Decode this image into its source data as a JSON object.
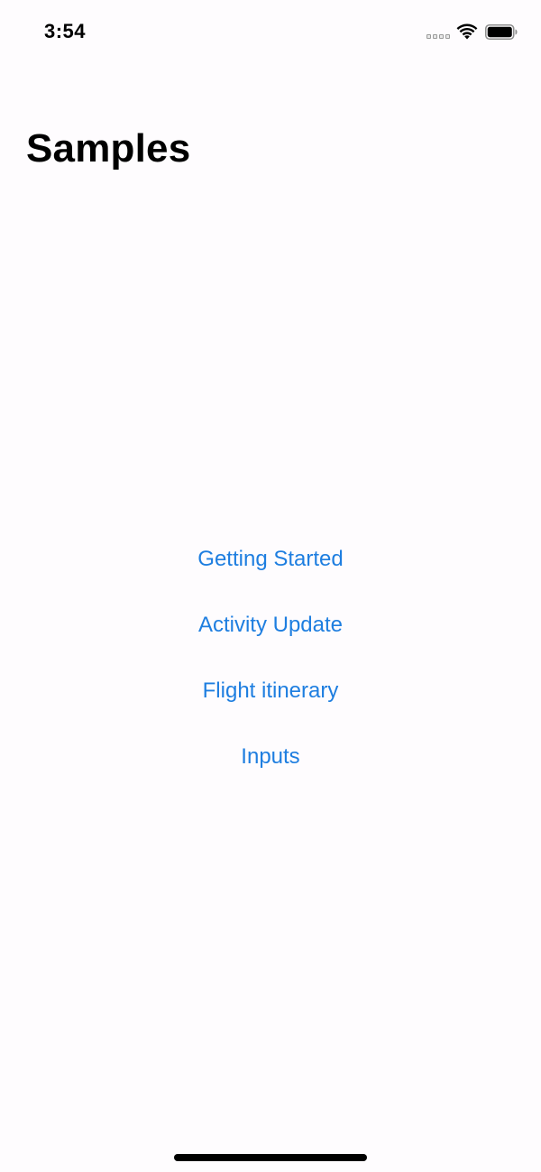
{
  "status_bar": {
    "time": "3:54",
    "icons": [
      "cellular-signal-icon",
      "wifi-icon",
      "battery-icon"
    ]
  },
  "page": {
    "title": "Samples"
  },
  "menu": {
    "items": [
      {
        "label": "Getting Started"
      },
      {
        "label": "Activity Update"
      },
      {
        "label": "Flight itinerary"
      },
      {
        "label": "Inputs"
      }
    ]
  },
  "colors": {
    "link": "#1e7ee0",
    "background": "#fefcfe",
    "text": "#000000"
  }
}
